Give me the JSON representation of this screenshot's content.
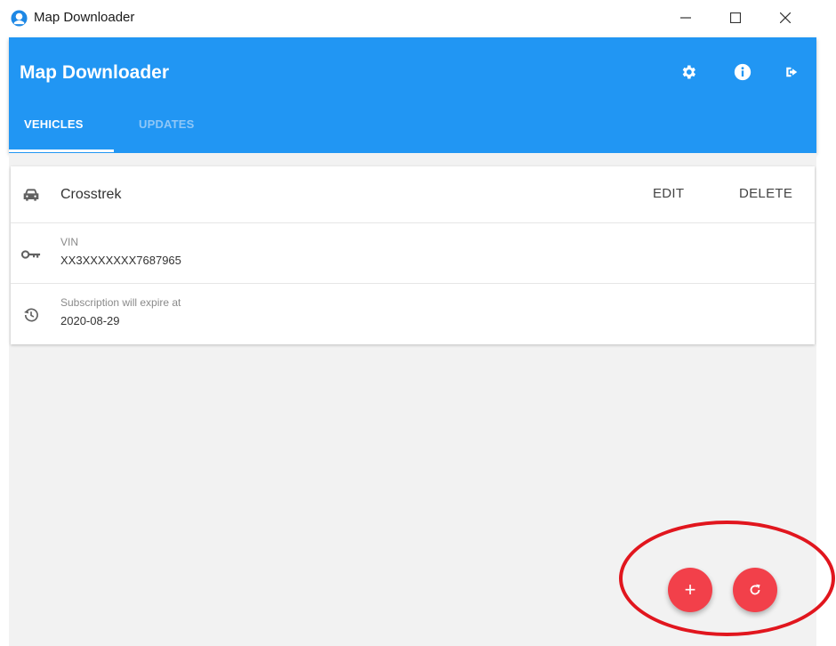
{
  "window": {
    "title": "Map Downloader",
    "controls": [
      "minimize",
      "maximize",
      "close"
    ]
  },
  "appbar": {
    "title": "Map Downloader",
    "color": "#2196f3",
    "icons": [
      "settings-gear-icon",
      "info-icon",
      "sign-out-icon"
    ],
    "tabs": [
      {
        "label": "VEHICLES",
        "active": true
      },
      {
        "label": "UPDATES",
        "active": false
      }
    ]
  },
  "vehicle": {
    "icon": "car-icon",
    "name": "Crosstrek",
    "edit_label": "EDIT",
    "delete_label": "DELETE",
    "vin": {
      "icon": "key-icon",
      "label": "VIN",
      "value": "XX3XXXXXXX7687965"
    },
    "subscription": {
      "icon": "history-icon",
      "label": "Subscription will expire at",
      "value": "2020-08-29"
    }
  },
  "fabs": {
    "color": "#f2404a",
    "add_label": "+",
    "refresh_icon": "refresh-icon"
  },
  "annotation": {
    "color": "#e1161e",
    "shape": "ellipse"
  }
}
